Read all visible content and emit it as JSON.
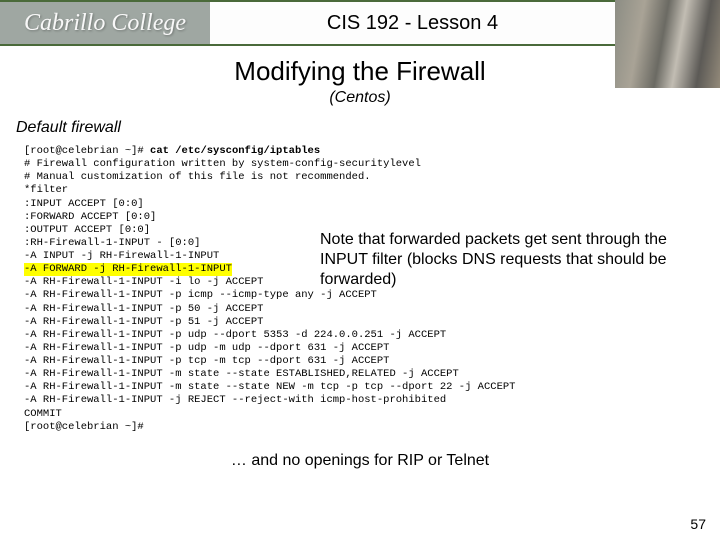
{
  "header": {
    "logo_text": "Cabrillo College",
    "course_title": "CIS 192 - Lesson 4"
  },
  "titles": {
    "main": "Modifying the Firewall",
    "sub": "(Centos)",
    "section": "Default firewall"
  },
  "terminal": {
    "prompt1": "[root@celebrian ~]# ",
    "command": "cat /etc/sysconfig/iptables",
    "lines": [
      "# Firewall configuration written by system-config-securitylevel",
      "# Manual customization of this file is not recommended.",
      "*filter",
      ":INPUT ACCEPT [0:0]",
      ":FORWARD ACCEPT [0:0]",
      ":OUTPUT ACCEPT [0:0]",
      ":RH-Firewall-1-INPUT - [0:0]",
      "-A INPUT -j RH-Firewall-1-INPUT"
    ],
    "highlighted": "-A FORWARD -j RH-Firewall-1-INPUT",
    "lines2": [
      "-A RH-Firewall-1-INPUT -i lo -j ACCEPT",
      "-A RH-Firewall-1-INPUT -p icmp --icmp-type any -j ACCEPT",
      "-A RH-Firewall-1-INPUT -p 50 -j ACCEPT",
      "-A RH-Firewall-1-INPUT -p 51 -j ACCEPT",
      "-A RH-Firewall-1-INPUT -p udp --dport 5353 -d 224.0.0.251 -j ACCEPT",
      "-A RH-Firewall-1-INPUT -p udp -m udp --dport 631 -j ACCEPT",
      "-A RH-Firewall-1-INPUT -p tcp -m tcp --dport 631 -j ACCEPT",
      "-A RH-Firewall-1-INPUT -m state --state ESTABLISHED,RELATED -j ACCEPT",
      "-A RH-Firewall-1-INPUT -m state --state NEW -m tcp -p tcp --dport 22 -j ACCEPT",
      "-A RH-Firewall-1-INPUT -j REJECT --reject-with icmp-host-prohibited",
      "COMMIT"
    ],
    "prompt2": "[root@celebrian ~]#"
  },
  "callout": "Note that forwarded packets get sent through the INPUT filter (blocks DNS requests that should be forwarded)",
  "bottom_note": "… and no openings for RIP or Telnet",
  "page_number": "57"
}
